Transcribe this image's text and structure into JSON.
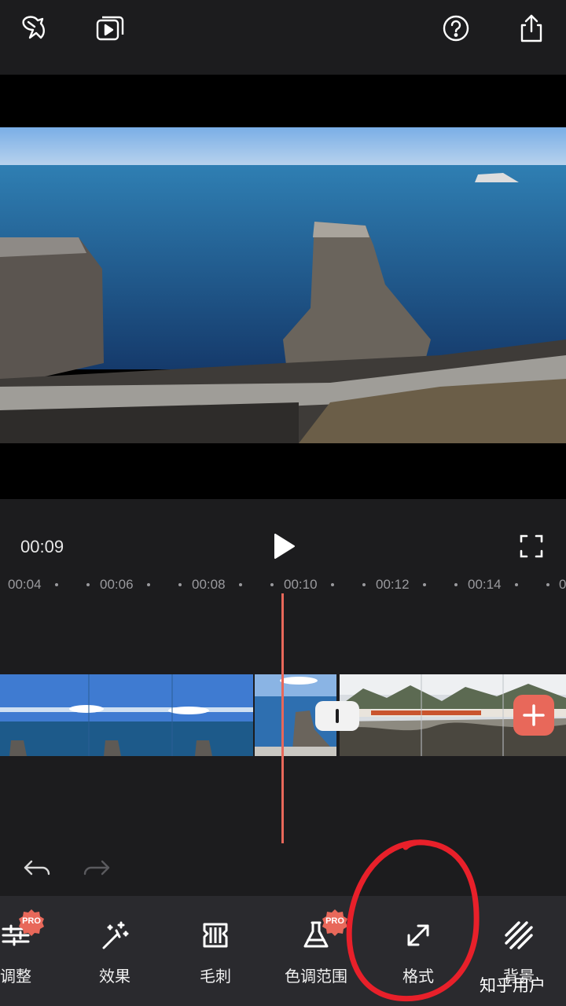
{
  "topbar": {
    "icons": [
      "bird-logo-icon",
      "play-gallery-icon",
      "help-icon",
      "share-icon"
    ]
  },
  "playback": {
    "current_time": "00:09"
  },
  "timeline": {
    "ruler_labels": [
      "00:04",
      "00:06",
      "00:08",
      "00:10",
      "00:12",
      "00:14",
      "0"
    ]
  },
  "toolbar": {
    "tools": [
      {
        "label": "调整",
        "icon": "sliders-icon",
        "pro": true
      },
      {
        "label": "效果",
        "icon": "magic-wand-icon",
        "pro": false
      },
      {
        "label": "毛刺",
        "icon": "glitch-icon",
        "pro": false
      },
      {
        "label": "色调范围",
        "icon": "flask-icon",
        "pro": true
      },
      {
        "label": "格式",
        "icon": "expand-arrows-icon",
        "pro": false
      },
      {
        "label": "背景",
        "icon": "stripes-icon",
        "pro": false
      }
    ],
    "pro_badge": "PRO"
  },
  "annotation": {
    "color": "#e8202a"
  },
  "watermark": "知乎用户",
  "colors": {
    "accent": "#e8685a",
    "background": "#1c1c1e",
    "toolbar_bg": "#2a2a2e"
  }
}
